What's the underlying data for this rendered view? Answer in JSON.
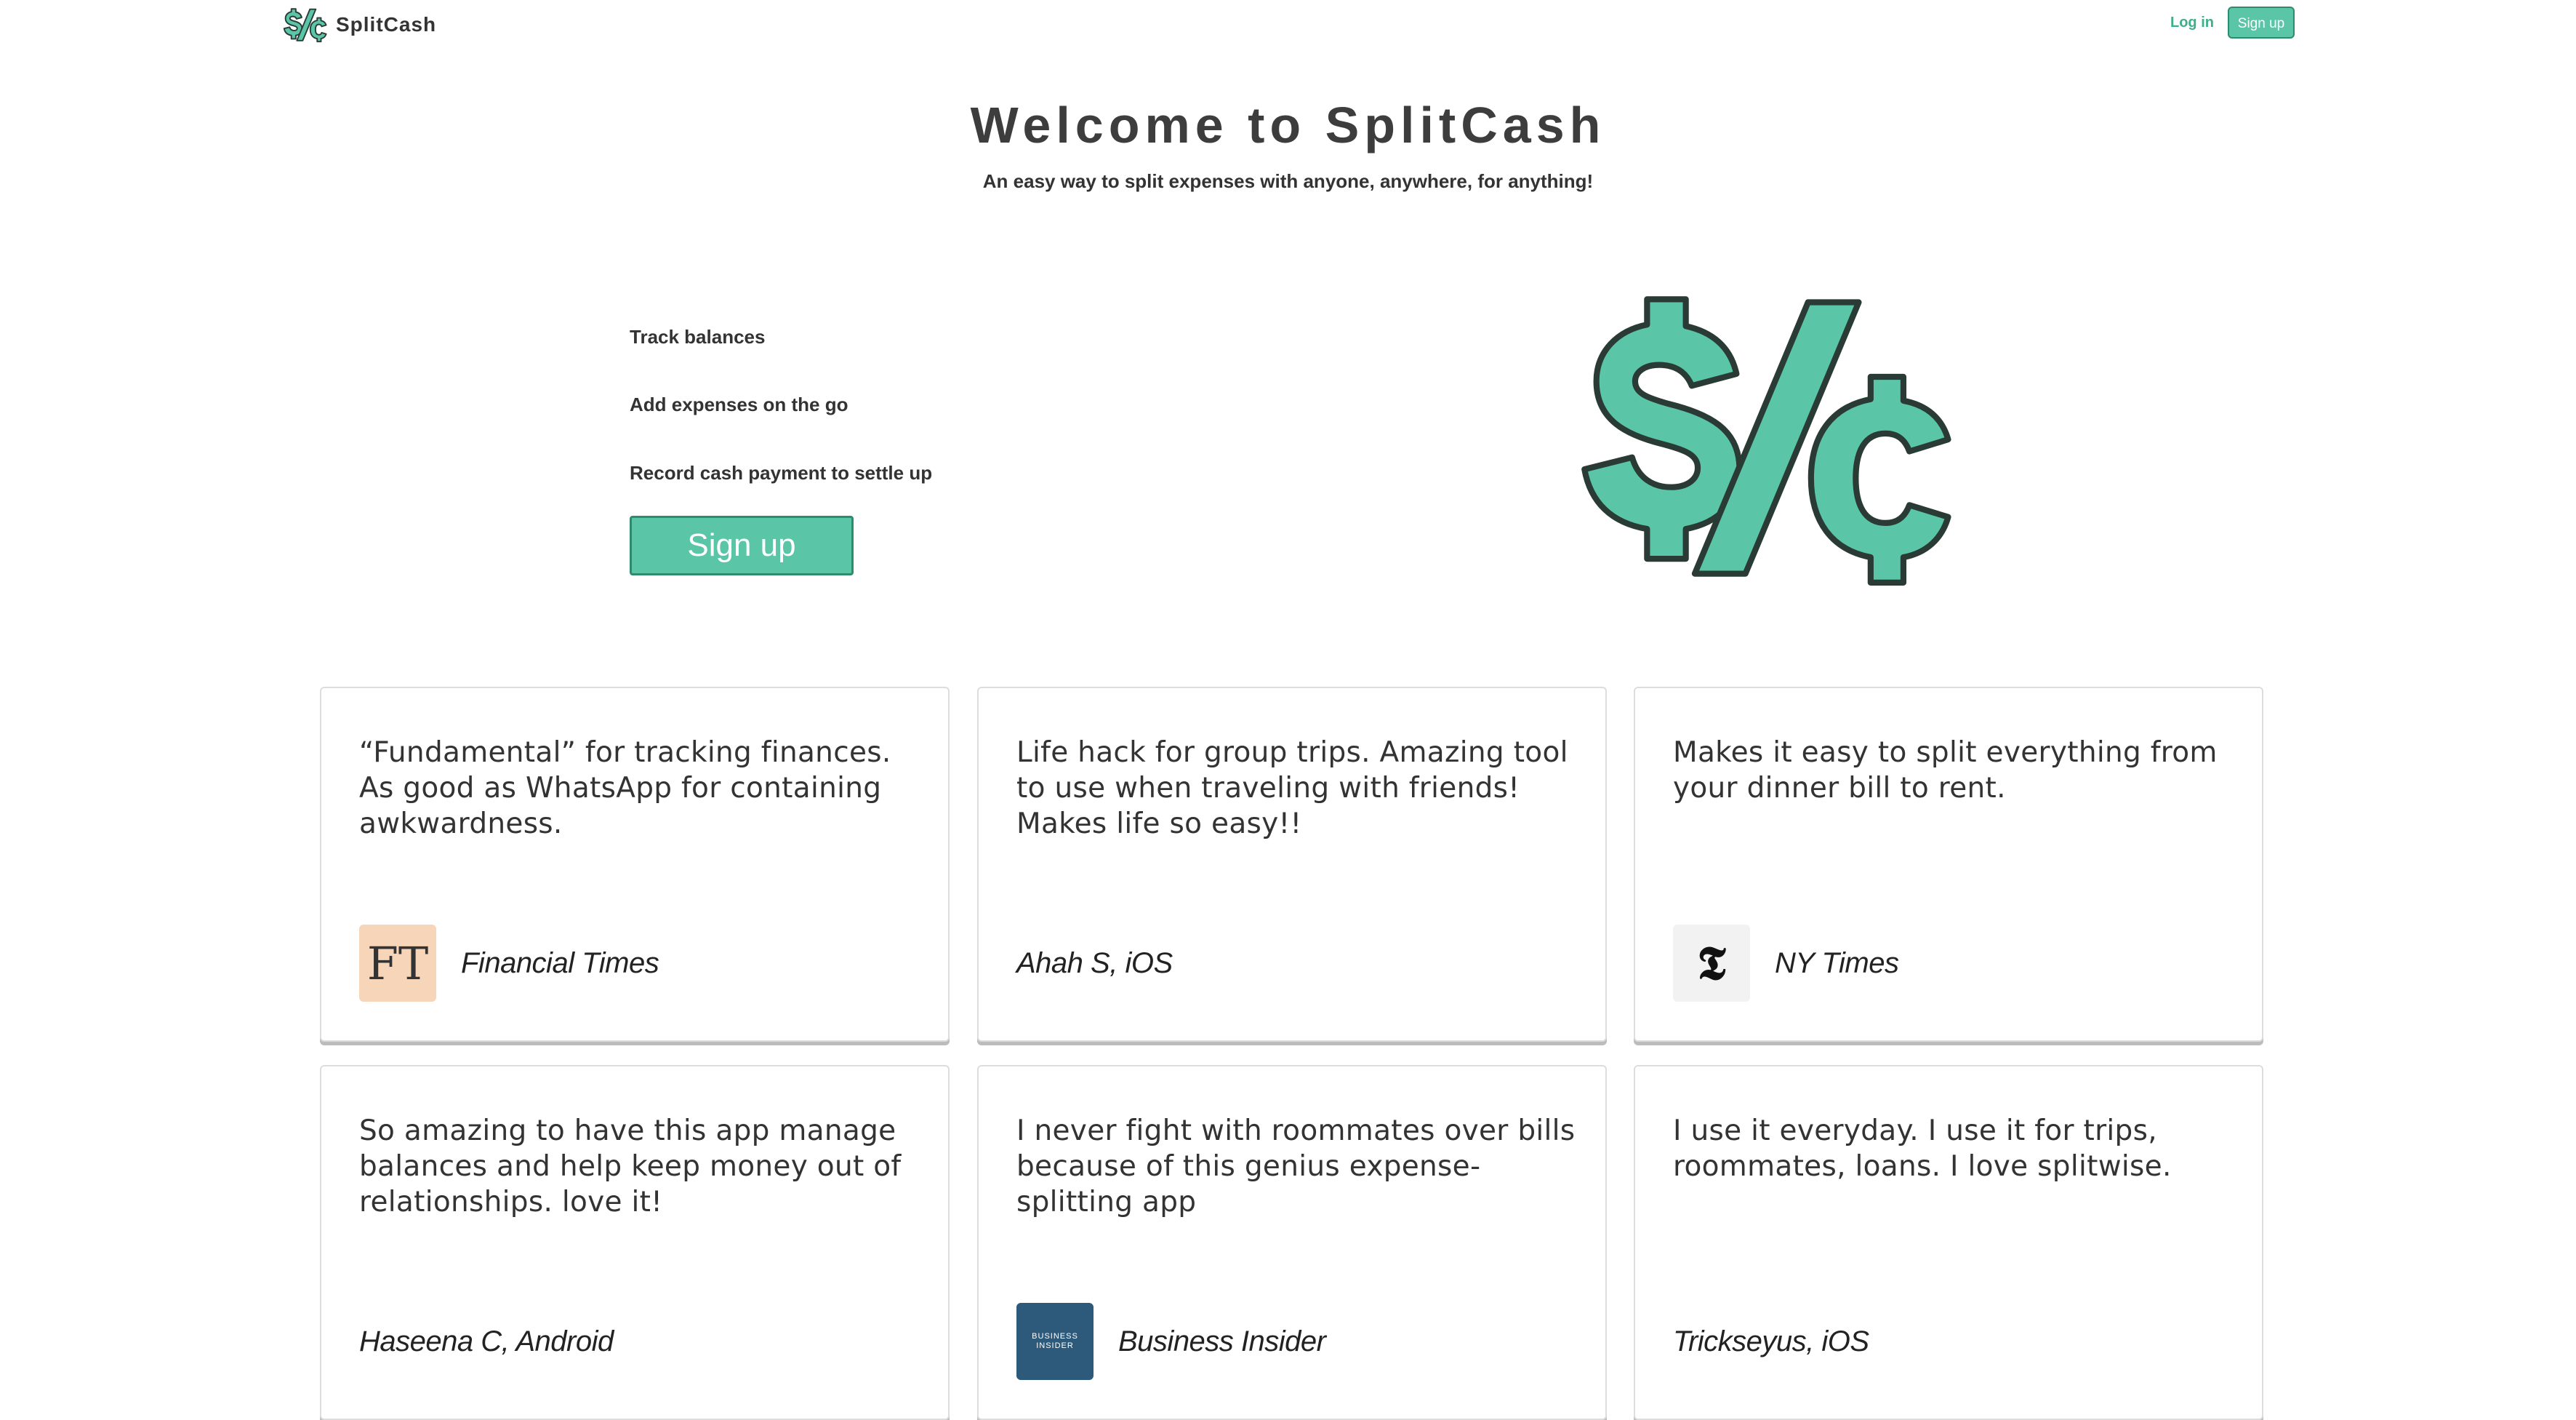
{
  "header": {
    "brand_name": "SplitCash",
    "login_label": "Log in",
    "signup_label": "Sign up"
  },
  "hero": {
    "title": "Welcome to SplitCash",
    "subtitle": "An easy way to split expenses with anyone, anywhere, for anything!",
    "features": [
      "Track balances",
      "Add expenses on the go",
      "Record cash payment to settle up"
    ],
    "signup_label": "Sign up",
    "logo_icon": "splitcash-logo-icon"
  },
  "colors": {
    "accent": "#5bc5a7",
    "accent_border": "#2e8c6e",
    "text": "#333333"
  },
  "testimonials": [
    {
      "quote": "“Fundamental” for tracking finances. As good as WhatsApp for containing awkwardness.",
      "author": "Financial Times",
      "avatar_text": "FT",
      "avatar_icon": "financial-times-logo"
    },
    {
      "quote": "Life hack for group trips. Amazing tool to use when traveling with friends! Makes life so easy!!",
      "author": "Ahah S, iOS"
    },
    {
      "quote": "Makes it easy to split everything from your dinner bill to rent.",
      "author": "NY Times",
      "avatar_text": "𝕿",
      "avatar_icon": "ny-times-logo"
    },
    {
      "quote": "So amazing to have this app manage balances and help keep money out of relationships. love it!",
      "author": "Haseena C, Android"
    },
    {
      "quote": "I never fight with roommates over bills because of this genius expense-splitting app",
      "author": "Business Insider",
      "avatar_line1": "BUSINESS",
      "avatar_line2": "INSIDER",
      "avatar_icon": "business-insider-logo"
    },
    {
      "quote": "I use it everyday. I use it for trips, roommates, loans. I love splitwise.",
      "author": "Trickseyus, iOS"
    }
  ]
}
